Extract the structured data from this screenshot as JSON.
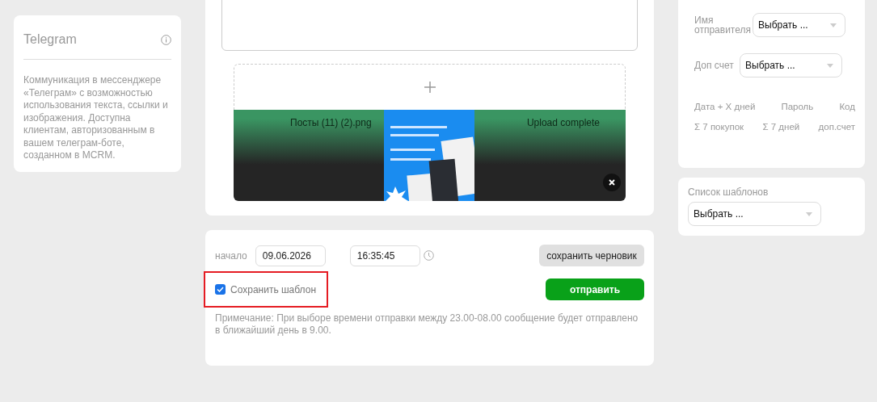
{
  "channel_card": {
    "title": "Telegram",
    "description": "Коммуникация в мессенджере «Телеграм» с возможностью использования текста, ссылки и изображения. Доступна клиентам, авторизованным в вашем телеграм-боте, созданном в MCRM."
  },
  "message": {
    "upload": {
      "file_name": "Посты (11) (2).png",
      "status": "Upload complete"
    }
  },
  "schedule": {
    "start_label": "начало",
    "date": "09.06.2026",
    "time": "16:35:45",
    "save_template": {
      "label": "Сохранить шаблон",
      "checked": true,
      "highlighted": true
    },
    "draft_button": "сохранить черновик",
    "send_button": "отправить",
    "note": "Примечание: При выборе времени отправки между 23.00-08.00 сообщение будет отправлено в ближайший день в 9.00."
  },
  "settings": {
    "fields": [
      {
        "label": "Имя отправителя",
        "value": "Выбрать ..."
      },
      {
        "label": "Доп счет",
        "value": "Выбрать ..."
      }
    ],
    "variables": [
      [
        "Дата + X дней",
        "Пароль",
        "Код"
      ],
      [
        "Σ 7 покупок",
        "Σ 7 дней",
        "доп.счет"
      ]
    ]
  },
  "templates": {
    "label": "Список шаблонов",
    "value": "Выбрать ..."
  }
}
